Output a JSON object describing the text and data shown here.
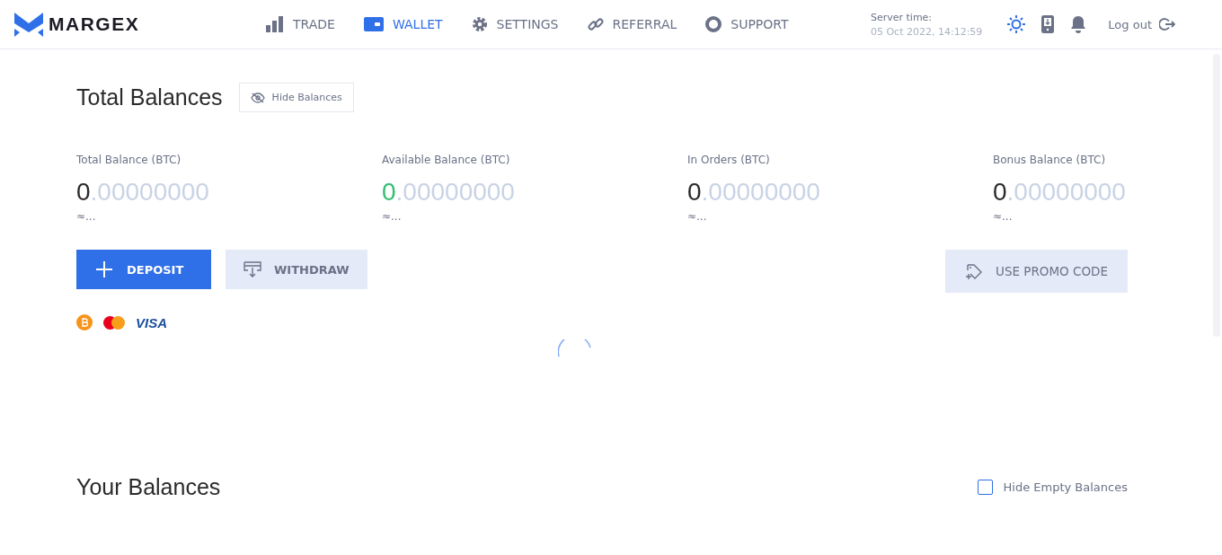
{
  "brand": {
    "name": "MARGEX"
  },
  "nav": [
    {
      "label": "TRADE",
      "kind": "chart",
      "selected": false
    },
    {
      "label": "WALLET",
      "kind": "wallet",
      "selected": true
    },
    {
      "label": "SETTINGS",
      "kind": "settings",
      "selected": false
    },
    {
      "label": "REFERRAL",
      "kind": "referral",
      "selected": false
    },
    {
      "label": "SUPPORT",
      "kind": "support",
      "selected": false
    }
  ],
  "server_time": {
    "label": "Server time:",
    "value": "05 Oct 2022, 14:12:59"
  },
  "logout": "Log out",
  "total_balances": {
    "title": "Total Balances",
    "hide_button": "Hide Balances"
  },
  "balances": [
    {
      "label": "Total Balance (BTC)",
      "integer": "0",
      "fraction": ".00000000",
      "approx": "≈...",
      "color": "#2b2b2b"
    },
    {
      "label": "Available Balance (BTC)",
      "integer": "0",
      "fraction": ".00000000",
      "approx": "≈...",
      "color": "#2fbf71"
    },
    {
      "label": "In Orders (BTC)",
      "integer": "0",
      "fraction": ".00000000",
      "approx": "≈...",
      "color": "#2b2b2b"
    },
    {
      "label": "Bonus Balance (BTC)",
      "integer": "0",
      "fraction": ".00000000",
      "approx": "≈...",
      "color": "#2b2b2b"
    }
  ],
  "actions": {
    "deposit": "DEPOSIT",
    "withdraw": "WITHDRAW",
    "promo": "USE PROMO CODE"
  },
  "payment_methods": [
    {
      "kind": "bitcoin"
    },
    {
      "kind": "mastercard"
    },
    {
      "kind": "visa",
      "label": "VISA"
    }
  ],
  "your_balances": {
    "title": "Your Balances",
    "hide_empty": {
      "label": "Hide Empty Balances",
      "checked": false
    }
  }
}
